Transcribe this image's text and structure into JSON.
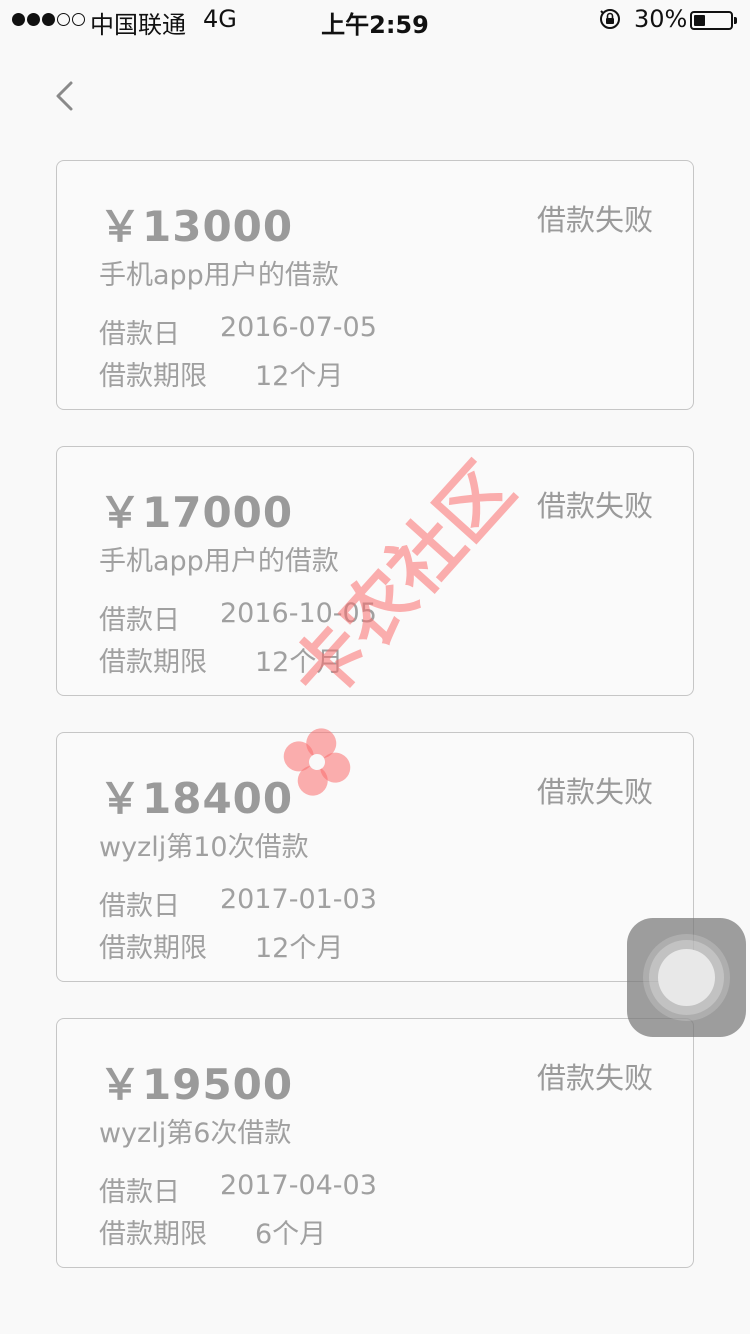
{
  "status_bar": {
    "carrier": "中国联通",
    "network": "4G",
    "time": "上午2:59",
    "battery_pct": "30%",
    "battery_level": 0.3,
    "signal_bars": 3,
    "signal_total": 5
  },
  "nav": {
    "back_icon": "chevron-left-icon"
  },
  "loans": [
    {
      "amount": "￥13000",
      "status": "借款失败",
      "desc": "手机app用户的借款",
      "date_label": "借款日",
      "date": "2016-07-05",
      "term_label": "借款期限",
      "term": "12个月"
    },
    {
      "amount": "￥17000",
      "status": "借款失败",
      "desc": "手机app用户的借款",
      "date_label": "借款日",
      "date": "2016-10-05",
      "term_label": "借款期限",
      "term": "12个月"
    },
    {
      "amount": "￥18400",
      "status": "借款失败",
      "desc": "wyzlj第10次借款",
      "date_label": "借款日",
      "date": "2017-01-03",
      "term_label": "借款期限",
      "term": "12个月"
    },
    {
      "amount": "￥19500",
      "status": "借款失败",
      "desc": "wyzlj第6次借款",
      "date_label": "借款日",
      "date": "2017-04-03",
      "term_label": "借款期限",
      "term": "6个月"
    }
  ],
  "watermark": {
    "text": "卡农社区",
    "color": "#fa6e6e"
  },
  "colors": {
    "background": "#f9f9f9",
    "text": "#9a9a9a",
    "border": "#c6c6c6"
  }
}
